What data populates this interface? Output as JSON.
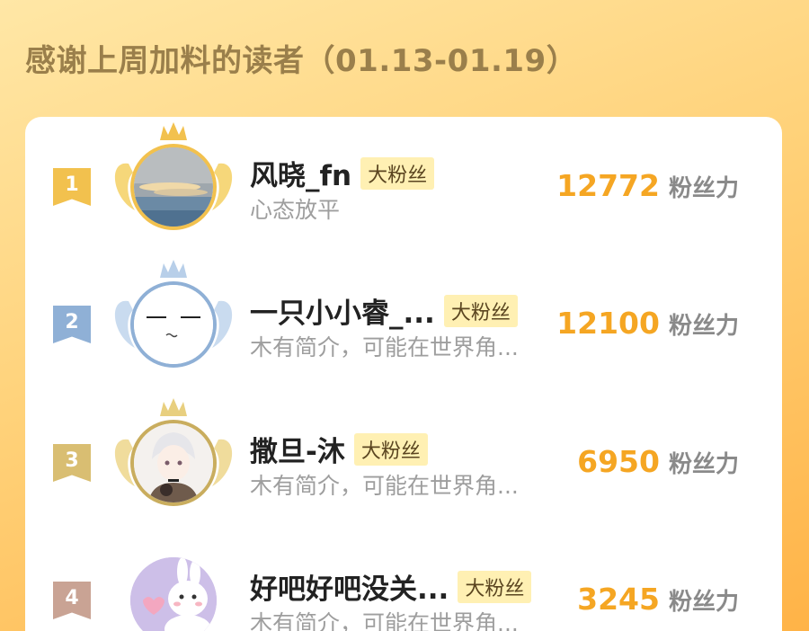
{
  "header": {
    "title": "感谢上周加料的读者（01.13-01.19）"
  },
  "colors": {
    "gold": "#f2c14e",
    "silver": "#8fb0d6",
    "bronze": "#d9be72",
    "fourth": "#c9a394",
    "score": "#f5a623"
  },
  "readers": [
    {
      "rank": "1",
      "name": "风晓_fn",
      "tag": "大粉丝",
      "bio": "心态放平",
      "score": "12772",
      "unit": "粉丝力",
      "avatar": "sky-landscape-avatar"
    },
    {
      "rank": "2",
      "name": "一只小小睿_...",
      "tag": "大粉丝",
      "bio": "木有简介，可能在世界角...",
      "score": "12100",
      "unit": "粉丝力",
      "avatar": "default-face-avatar"
    },
    {
      "rank": "3",
      "name": "撒旦-沐",
      "tag": "大粉丝",
      "bio": "木有简介，可能在世界角...",
      "score": "6950",
      "unit": "粉丝力",
      "avatar": "anime-character-avatar"
    },
    {
      "rank": "4",
      "name": "好吧好吧没关...",
      "tag": "大粉丝",
      "bio": "木有简介，可能在世界角...",
      "score": "3245",
      "unit": "粉丝力",
      "avatar": "bunny-avatar"
    }
  ]
}
